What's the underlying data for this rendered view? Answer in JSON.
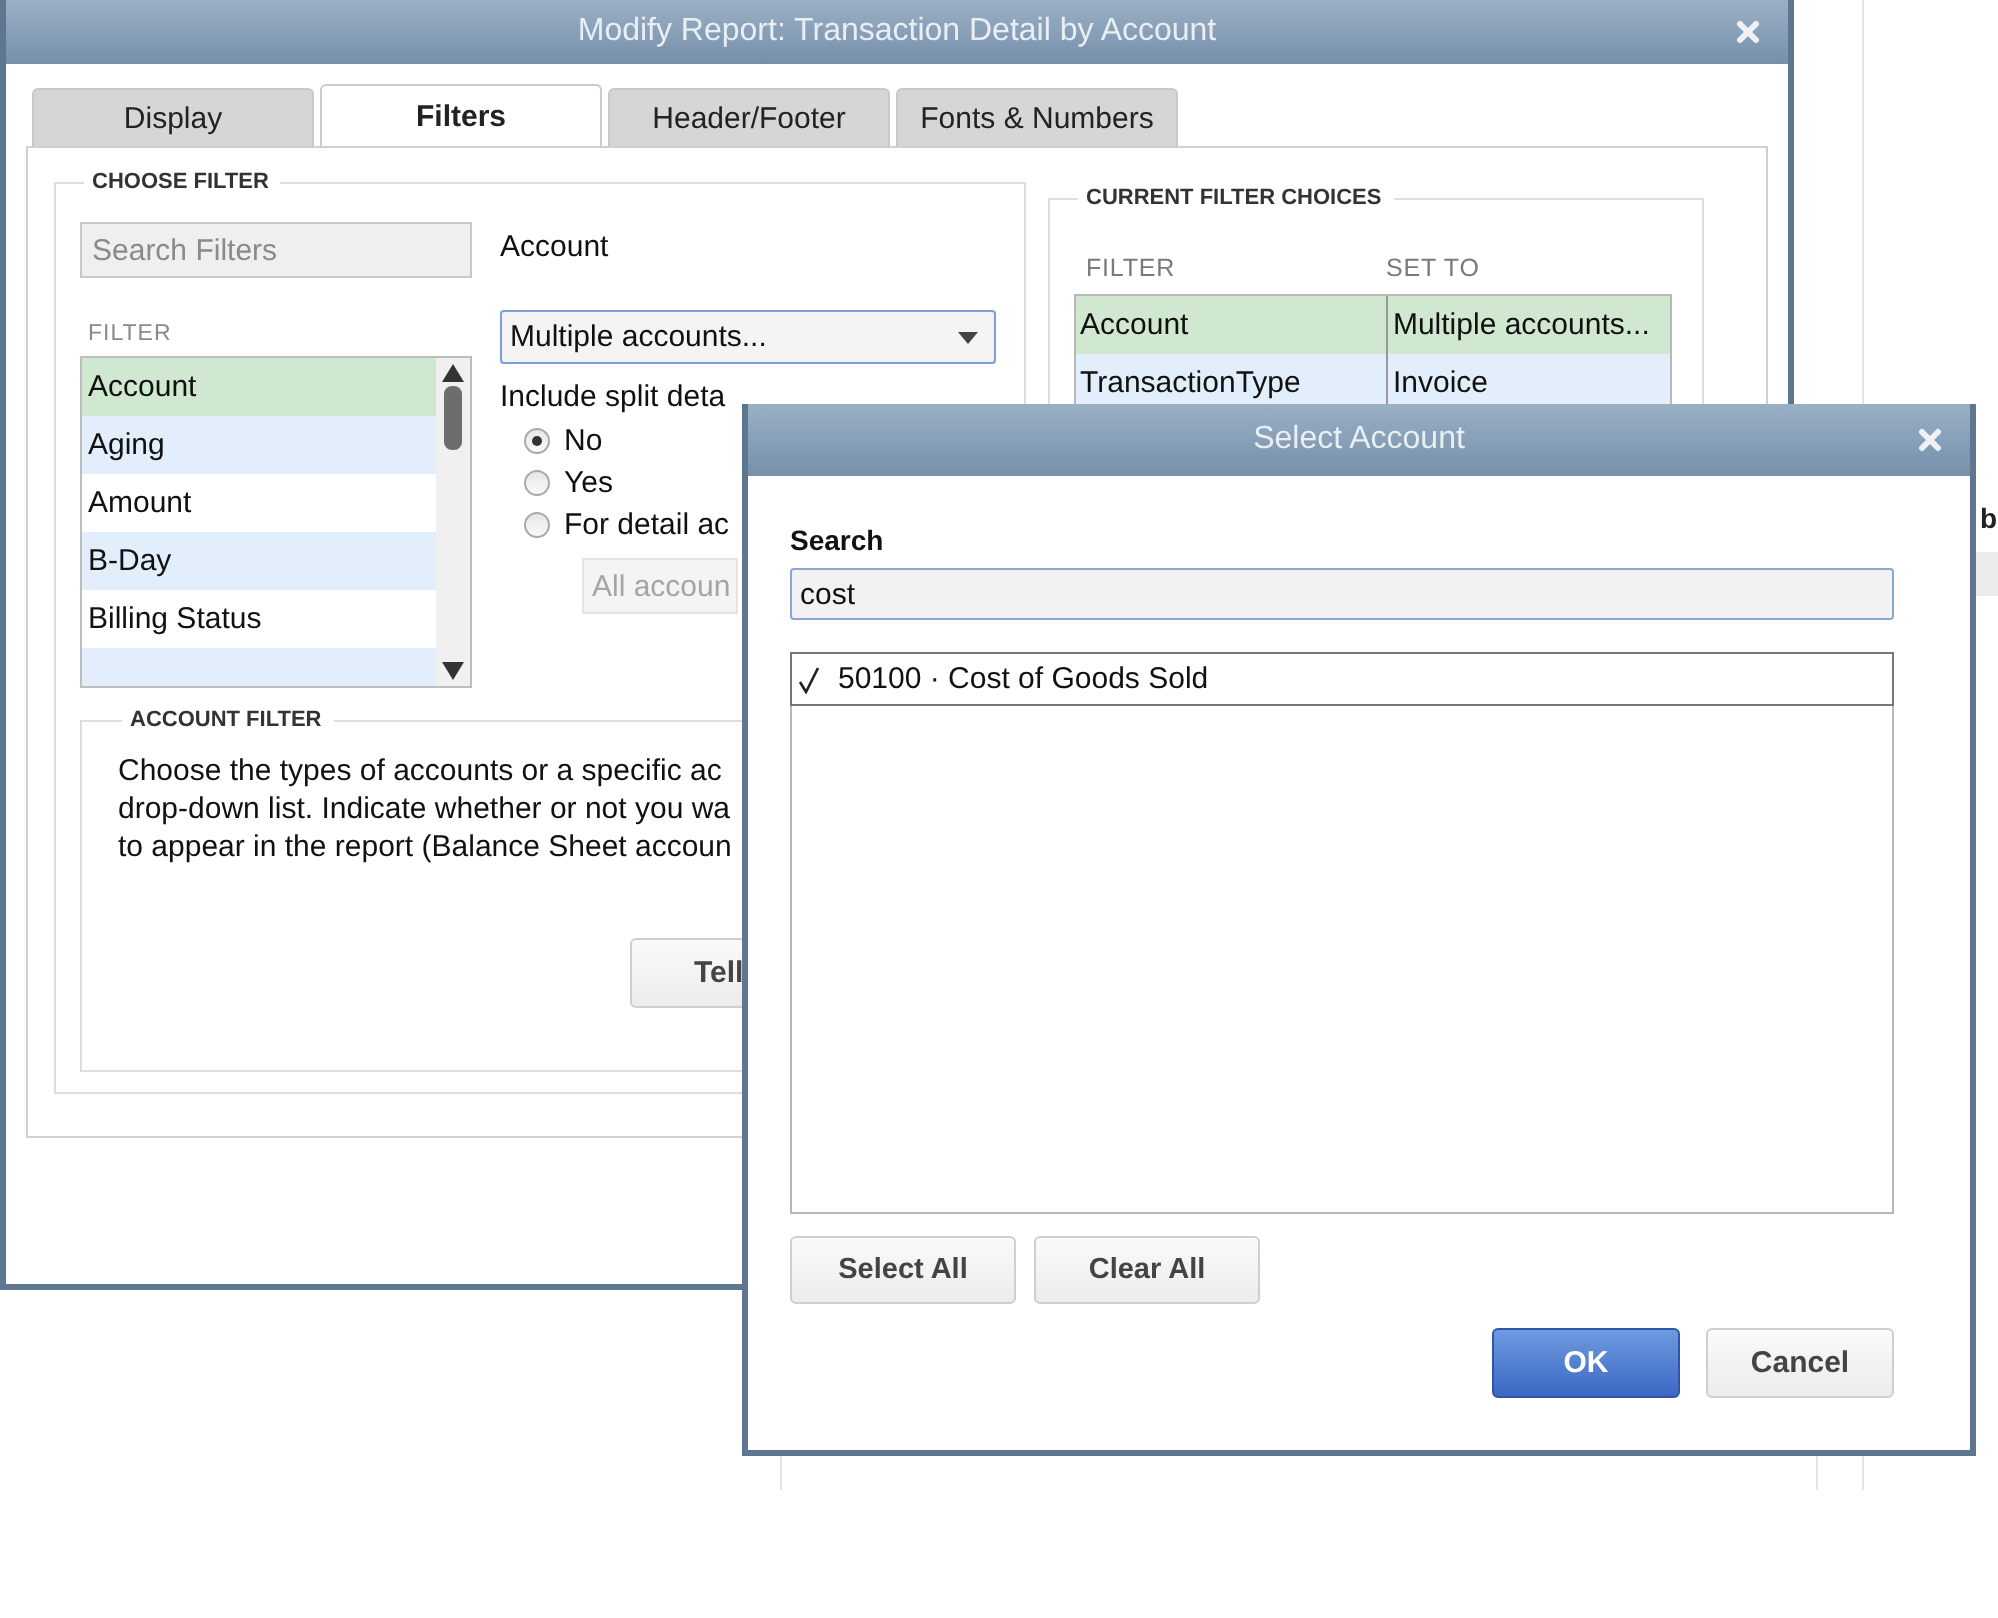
{
  "background": {
    "fragment": "b"
  },
  "window": {
    "title": "Modify Report: Transaction Detail by Account",
    "tabs": [
      {
        "label": "Display",
        "selected": false
      },
      {
        "label": "Filters",
        "selected": true
      },
      {
        "label": "Header/Footer",
        "selected": false
      },
      {
        "label": "Fonts & Numbers",
        "selected": false
      }
    ],
    "choose_filter": {
      "heading": "CHOOSE FILTER",
      "search": {
        "placeholder": "Search Filters"
      },
      "list_heading": "FILTER",
      "items": [
        {
          "label": "Account",
          "selected": true
        },
        {
          "label": "Aging",
          "selected": false
        },
        {
          "label": "Amount",
          "selected": false
        },
        {
          "label": "B-Day",
          "selected": false
        },
        {
          "label": "Billing Status",
          "selected": false
        }
      ],
      "field_label": "Account",
      "dropdown": "Multiple accounts...",
      "split_label": "Include split deta",
      "options": [
        {
          "label": "No",
          "selected": true
        },
        {
          "label": "Yes",
          "selected": false
        },
        {
          "label": "For detail ac",
          "selected": false
        }
      ],
      "detail_field": {
        "placeholder": "All accoun"
      }
    },
    "account_filter": {
      "heading": "ACCOUNT FILTER",
      "lines": [
        "Choose the types of accounts or a specific ac",
        "drop-down list. Indicate whether or not you wa",
        "to appear in the report (Balance Sheet accoun"
      ],
      "button": "Tell"
    },
    "current_filters": {
      "heading": "CURRENT FILTER CHOICES",
      "columns": [
        "FILTER",
        "SET TO"
      ],
      "rows": [
        {
          "filter": "Account",
          "set_to": "Multiple accounts...",
          "selected": true
        },
        {
          "filter": "TransactionType",
          "set_to": "Invoice",
          "selected": false
        }
      ]
    }
  },
  "dialog": {
    "title": "Select Account",
    "search_label": "Search",
    "search_value": "cost",
    "items": [
      {
        "label": "50100 · Cost of Goods Sold",
        "checked": true
      }
    ],
    "list_buttons": [
      "Select All",
      "Clear All"
    ],
    "buttons": [
      {
        "label": "OK",
        "kind": "primary"
      },
      {
        "label": "Cancel",
        "kind": "normal"
      }
    ]
  }
}
